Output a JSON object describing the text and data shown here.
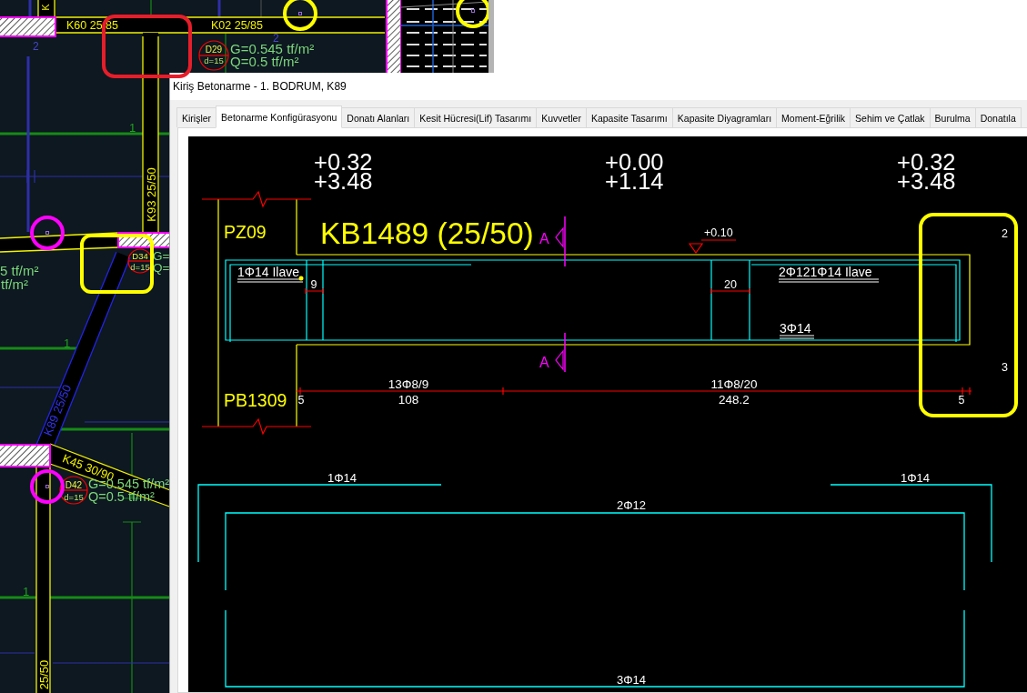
{
  "plan": {
    "beams": [
      {
        "label": "K"
      },
      {
        "label": "K60 25/85"
      },
      {
        "label": "K02 25/85"
      },
      {
        "label": "K93 25/50"
      },
      {
        "label": "K89 25/50"
      },
      {
        "label": "K45 30/90"
      },
      {
        "label": "25/50"
      }
    ],
    "slabs": [
      {
        "tag": "D29",
        "thickness": "d=15",
        "dead_load": "G=0.545 tf/m²",
        "live_load": "Q=0.5 tf/m²"
      },
      {
        "tag": "D34",
        "thickness": "d=15",
        "dead_load": "G=",
        "live_load": "Q="
      },
      {
        "tag": "D42",
        "thickness": "d=15",
        "dead_load": "G=0.545 tf/m²",
        "live_load": "Q=0.5 tf/m²"
      }
    ],
    "cut_loads": [
      "5 tf/m²",
      "tf/m²"
    ],
    "axis_numbers": [
      "1",
      "1",
      "1"
    ],
    "span_numbers": [
      "2",
      "2"
    ]
  },
  "window": {
    "title": "Kiriş Betonarme - 1. BODRUM, K89",
    "tabs": [
      {
        "label": "Kirişler",
        "selected": false
      },
      {
        "label": "Betonarme Konfigürasyonu",
        "selected": true
      },
      {
        "label": "Donatı Alanları",
        "selected": false
      },
      {
        "label": "Kesit Hücresi(Lif) Tasarımı",
        "selected": false
      },
      {
        "label": "Kuvvetler",
        "selected": false
      },
      {
        "label": "Kapasite Tasarımı",
        "selected": false
      },
      {
        "label": "Kapasite Diyagramları",
        "selected": false
      },
      {
        "label": "Moment-Eğrilik",
        "selected": false
      },
      {
        "label": "Sehim ve Çatlak",
        "selected": false
      },
      {
        "label": "Burulma",
        "selected": false
      },
      {
        "label": "Donatıla",
        "selected": false
      }
    ]
  },
  "elevation": {
    "levels": [
      {
        "upper": "+0.32",
        "lower": "+3.48"
      },
      {
        "upper": "+0.00",
        "lower": "+1.14"
      },
      {
        "upper": "+0.32",
        "lower": "+3.48"
      }
    ],
    "supports": [
      "PZ09",
      "PB1309"
    ],
    "title": "KB1489 (25/50)",
    "section_marks": [
      "A",
      "A"
    ],
    "level_mark": "+0.10",
    "bar_notes": [
      "1Φ14 Ilave",
      "2Φ121Φ14 Ilave",
      "3Φ14"
    ],
    "spacings": [
      "9",
      "20"
    ],
    "stirrup_zones": [
      {
        "spec": "13Φ8/9",
        "length": "108"
      },
      {
        "spec": "11Φ8/20",
        "length": "248.2"
      }
    ],
    "end_covers": [
      "5",
      "5"
    ],
    "edge_labels": [
      "2",
      "3"
    ]
  },
  "bar_schedule": [
    {
      "kind": "extra-left",
      "label": "1Φ14"
    },
    {
      "kind": "extra-right",
      "label": "1Φ14"
    },
    {
      "kind": "top",
      "label": "2Φ12"
    },
    {
      "kind": "bottom",
      "label": "3Φ14"
    }
  ]
}
